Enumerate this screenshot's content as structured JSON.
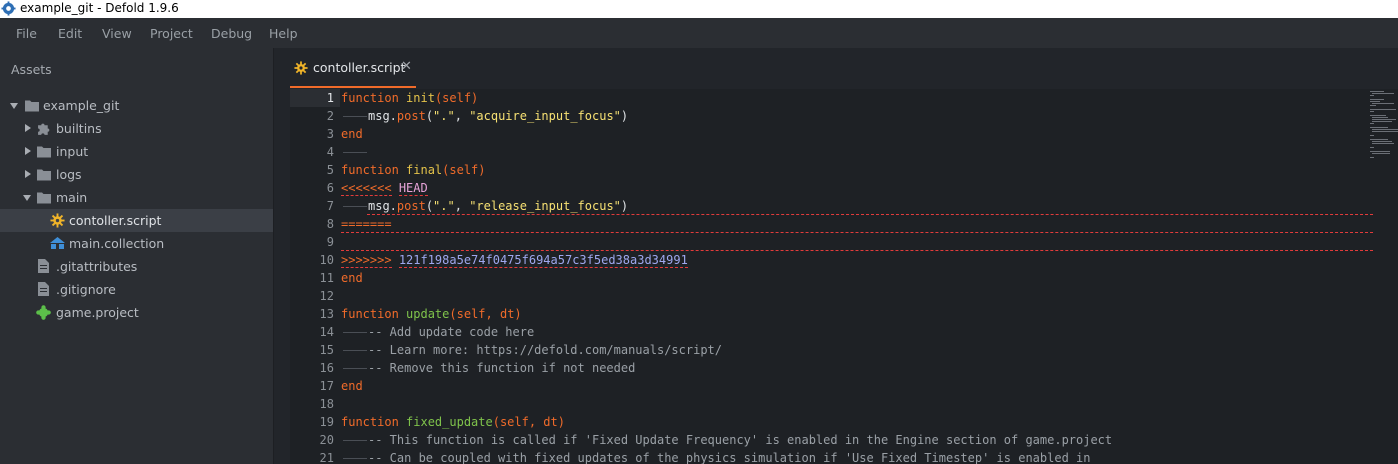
{
  "window": {
    "title": "example_git - Defold 1.9.6"
  },
  "menu": [
    "File",
    "Edit",
    "View",
    "Project",
    "Debug",
    "Help"
  ],
  "assets": {
    "title": "Assets",
    "tree": [
      {
        "label": "example_git",
        "icon": "folder-icon",
        "expanded": true
      },
      {
        "label": "builtins",
        "icon": "puzzle-icon"
      },
      {
        "label": "input",
        "icon": "folder-icon"
      },
      {
        "label": "logs",
        "icon": "folder-icon"
      },
      {
        "label": "main",
        "icon": "folder-icon",
        "expanded": true
      },
      {
        "label": "contoller.script",
        "icon": "gear-icon",
        "selected": true
      },
      {
        "label": "main.collection",
        "icon": "collection-icon"
      },
      {
        "label": ".gitattributes",
        "icon": "file-icon"
      },
      {
        "label": ".gitignore",
        "icon": "file-icon"
      },
      {
        "label": "game.project",
        "icon": "game-project-icon"
      }
    ]
  },
  "editor": {
    "tab_label": "contoller.script",
    "close_glyph": "✕",
    "current_line": 1,
    "lines": [
      {
        "n": "1"
      },
      {
        "n": "2"
      },
      {
        "n": "3"
      },
      {
        "n": "4"
      },
      {
        "n": "5"
      },
      {
        "n": "6"
      },
      {
        "n": "7"
      },
      {
        "n": "8"
      },
      {
        "n": "9"
      },
      {
        "n": "10"
      },
      {
        "n": "11"
      },
      {
        "n": "12"
      },
      {
        "n": "13"
      },
      {
        "n": "14"
      },
      {
        "n": "15"
      },
      {
        "n": "16"
      },
      {
        "n": "17"
      },
      {
        "n": "18"
      },
      {
        "n": "19"
      },
      {
        "n": "20"
      },
      {
        "n": "21"
      }
    ],
    "code": {
      "l1_kw": "function",
      "l1_fn": "init",
      "l1_args": "(self)",
      "l2_obj": "msg.",
      "l2_fn": "post",
      "l2_open": "(",
      "l2_s1": "\".\"",
      "l2_comma": ", ",
      "l2_s2": "\"acquire_input_focus\"",
      "l2_close": ")",
      "l3": "end",
      "l5_kw": "function",
      "l5_fn": "final",
      "l5_args": "(self)",
      "l6_marker": "<<<<<<<",
      "l6_head": "HEAD",
      "l7_obj": "msg.",
      "l7_fn": "post",
      "l7_open": "(",
      "l7_s1": "\".\"",
      "l7_comma": ", ",
      "l7_s2": "\"release_input_focus\"",
      "l7_close": ")",
      "l8": "=======",
      "l10_marker": ">>>>>>>",
      "l10_hash": "121f198a5e74f0475f694a57c3f5ed38a3d34991",
      "l11": "end",
      "l13_kw": "function",
      "l13_fn": "update",
      "l13_args": "(self, dt)",
      "l14": "-- Add update code here",
      "l15": "-- Learn more: https://defold.com/manuals/script/",
      "l16": "-- Remove this function if not needed",
      "l17": "end",
      "l19_kw": "function",
      "l19_fn": "fixed_update",
      "l19_args": "(self, dt)",
      "l20": "-- This function is called if 'Fixed Update Frequency' is enabled in the Engine section of game.project",
      "l21": "-- Can be coupled with fixed updates of the physics simulation if 'Use Fixed Timestep' is enabled in"
    }
  },
  "colors": {
    "accent": "#f06b2a",
    "keyword": "#f06b2a",
    "function_name": "#e3c24a",
    "string": "#f7e173",
    "conflict_underline": "#e23b3b"
  }
}
